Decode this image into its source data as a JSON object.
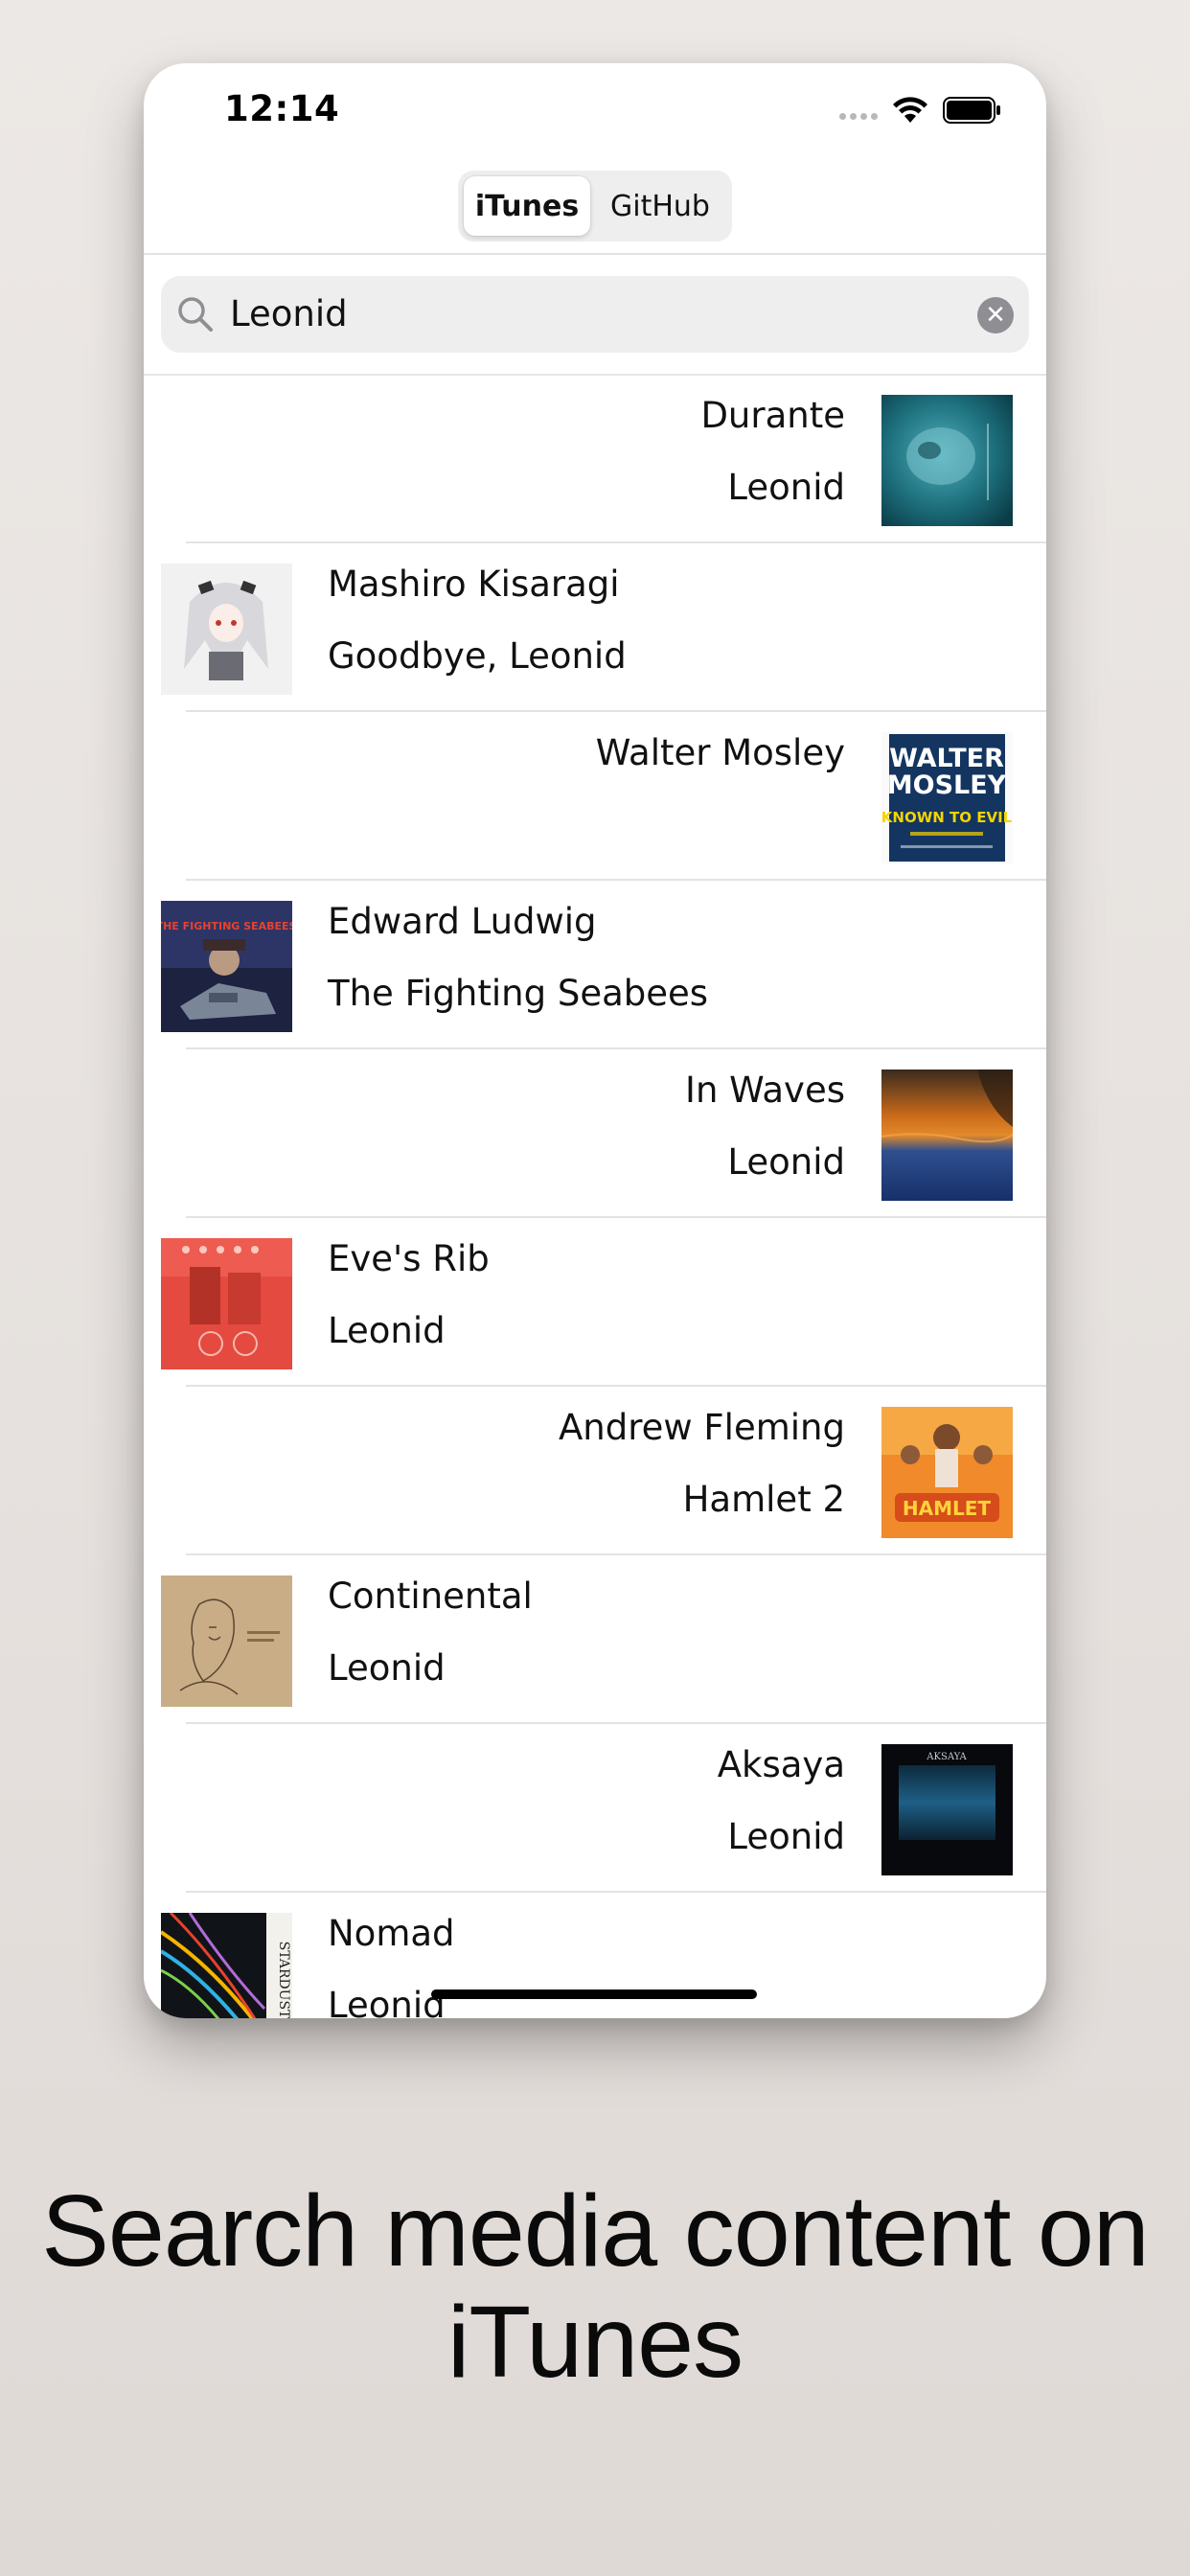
{
  "status_bar": {
    "time": "12:14"
  },
  "segmented": {
    "items": [
      "iTunes",
      "GitHub"
    ],
    "selected": "iTunes"
  },
  "search": {
    "value": "Leonid",
    "icon": "search-icon",
    "clear_icon": "clear-icon"
  },
  "results": [
    {
      "title": "Durante",
      "subtitle": "Leonid",
      "align": "right",
      "art": "teal underwater face artwork"
    },
    {
      "title": "Mashiro Kisaragi",
      "subtitle": "Goodbye, Leonid",
      "align": "left",
      "art": "anime girl white hair"
    },
    {
      "title": "Walter Mosley",
      "subtitle": "",
      "align": "right",
      "art": "book cover WALTER MOSLEY KNOWN TO EVIL"
    },
    {
      "title": "Edward Ludwig",
      "subtitle": "The Fighting Seabees",
      "align": "left",
      "art": "movie poster The Fighting Seabees"
    },
    {
      "title": "In Waves",
      "subtitle": "Leonid",
      "align": "right",
      "art": "orange sunset over blue water"
    },
    {
      "title": "Eve's Rib",
      "subtitle": "Leonid",
      "align": "left",
      "art": "red vintage photo"
    },
    {
      "title": "Andrew Fleming",
      "subtitle": "Hamlet 2",
      "align": "right",
      "art": "orange poster HAMLET 2"
    },
    {
      "title": "Continental",
      "subtitle": "Leonid",
      "align": "left",
      "art": "sketch on tan paper"
    },
    {
      "title": "Aksaya",
      "subtitle": "Leonid",
      "align": "right",
      "art": "dark blue square AKSAYA"
    },
    {
      "title": "Nomad",
      "subtitle": "Leonid",
      "align": "left",
      "art": "colorful streaks STARDUST"
    }
  ],
  "art_text": {
    "walter": "WALTER",
    "mosley": "MOSLEY",
    "known": "KNOWN TO EVIL",
    "seabees": "THE FIGHTING SEABEES",
    "hamlet": "HAMLET",
    "aksaya": "AKSAYA",
    "stardust": "STARDUST"
  },
  "caption": {
    "line1": "Search media content on",
    "line2": "iTunes"
  },
  "colors": {
    "background": "#e9e5e2",
    "segment_bg": "#eeeeef",
    "separator": "#e3e3e5",
    "text": "#111111"
  }
}
